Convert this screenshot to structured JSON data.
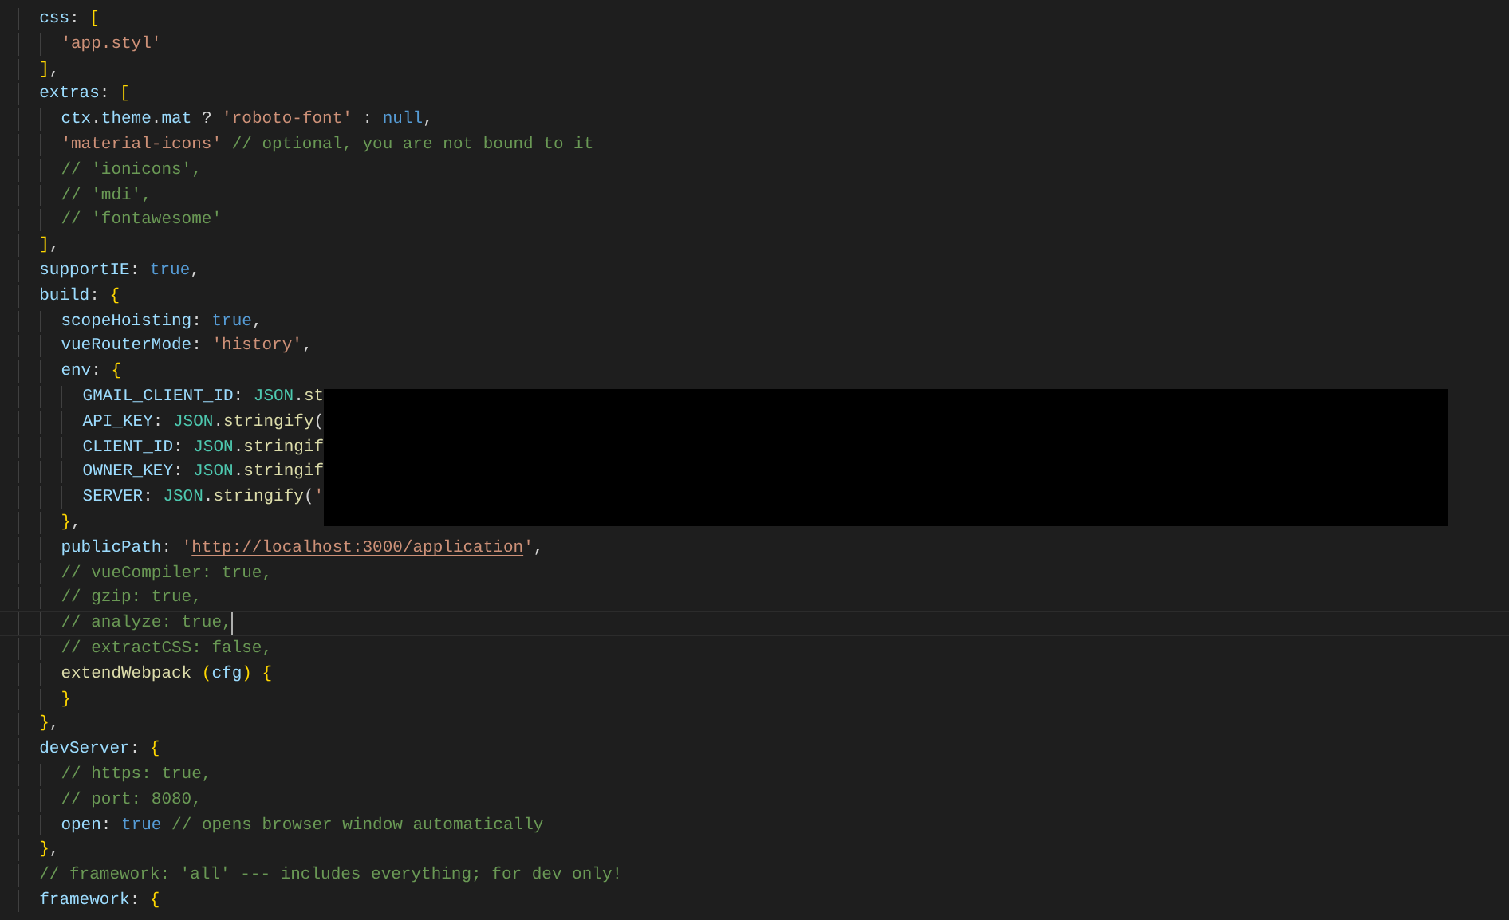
{
  "editor": {
    "lines": [
      {
        "tokens": [
          {
            "kind": "prop",
            "text": "css"
          },
          {
            "kind": "punct",
            "text": ": "
          },
          {
            "kind": "bracket",
            "text": "["
          }
        ],
        "children": [
          {
            "tokens": [
              {
                "kind": "string",
                "text": "'app.styl'"
              }
            ]
          }
        ]
      },
      {
        "tokens": [
          {
            "kind": "bracket",
            "text": "]"
          },
          {
            "kind": "punct",
            "text": ","
          }
        ]
      },
      {
        "tokens": [
          {
            "kind": "prop",
            "text": "extras"
          },
          {
            "kind": "punct",
            "text": ": "
          },
          {
            "kind": "bracket",
            "text": "["
          }
        ],
        "children": [
          {
            "tokens": [
              {
                "kind": "prop",
                "text": "ctx"
              },
              {
                "kind": "punct",
                "text": "."
              },
              {
                "kind": "prop",
                "text": "theme"
              },
              {
                "kind": "punct",
                "text": "."
              },
              {
                "kind": "prop",
                "text": "mat"
              },
              {
                "kind": "punct",
                "text": " ? "
              },
              {
                "kind": "string",
                "text": "'roboto-font'"
              },
              {
                "kind": "punct",
                "text": " : "
              },
              {
                "kind": "keyword",
                "text": "null"
              },
              {
                "kind": "punct",
                "text": ","
              }
            ]
          },
          {
            "tokens": [
              {
                "kind": "string",
                "text": "'material-icons'"
              },
              {
                "kind": "comment",
                "text": " // optional, you are not bound to it"
              }
            ]
          },
          {
            "tokens": [
              {
                "kind": "comment",
                "text": "// 'ionicons',"
              }
            ]
          },
          {
            "tokens": [
              {
                "kind": "comment",
                "text": "// 'mdi',"
              }
            ]
          },
          {
            "tokens": [
              {
                "kind": "comment",
                "text": "// 'fontawesome'"
              }
            ]
          }
        ]
      },
      {
        "tokens": [
          {
            "kind": "bracket",
            "text": "]"
          },
          {
            "kind": "punct",
            "text": ","
          }
        ]
      },
      {
        "tokens": [
          {
            "kind": "prop",
            "text": "supportIE"
          },
          {
            "kind": "punct",
            "text": ": "
          },
          {
            "kind": "keyword",
            "text": "true"
          },
          {
            "kind": "punct",
            "text": ","
          }
        ]
      },
      {
        "tokens": [
          {
            "kind": "prop",
            "text": "build"
          },
          {
            "kind": "punct",
            "text": ": "
          },
          {
            "kind": "bracket",
            "text": "{"
          }
        ],
        "children": [
          {
            "tokens": [
              {
                "kind": "prop",
                "text": "scopeHoisting"
              },
              {
                "kind": "punct",
                "text": ": "
              },
              {
                "kind": "keyword",
                "text": "true"
              },
              {
                "kind": "punct",
                "text": ","
              }
            ]
          },
          {
            "tokens": [
              {
                "kind": "prop",
                "text": "vueRouterMode"
              },
              {
                "kind": "punct",
                "text": ": "
              },
              {
                "kind": "string",
                "text": "'history'"
              },
              {
                "kind": "punct",
                "text": ","
              }
            ]
          },
          {
            "tokens": [
              {
                "kind": "prop",
                "text": "env"
              },
              {
                "kind": "punct",
                "text": ": "
              },
              {
                "kind": "bracket",
                "text": "{"
              }
            ],
            "children": [
              {
                "tokens": [
                  {
                    "kind": "prop",
                    "text": "GMAIL_CLIENT_ID"
                  },
                  {
                    "kind": "punct",
                    "text": ": "
                  },
                  {
                    "kind": "object",
                    "text": "JSON"
                  },
                  {
                    "kind": "punct",
                    "text": "."
                  },
                  {
                    "kind": "func",
                    "text": "st"
                  }
                ]
              },
              {
                "tokens": [
                  {
                    "kind": "prop",
                    "text": "API_KEY"
                  },
                  {
                    "kind": "punct",
                    "text": ": "
                  },
                  {
                    "kind": "object",
                    "text": "JSON"
                  },
                  {
                    "kind": "punct",
                    "text": "."
                  },
                  {
                    "kind": "func",
                    "text": "stringify"
                  },
                  {
                    "kind": "punct",
                    "text": "("
                  }
                ]
              },
              {
                "tokens": [
                  {
                    "kind": "prop",
                    "text": "CLIENT_ID"
                  },
                  {
                    "kind": "punct",
                    "text": ": "
                  },
                  {
                    "kind": "object",
                    "text": "JSON"
                  },
                  {
                    "kind": "punct",
                    "text": "."
                  },
                  {
                    "kind": "func",
                    "text": "stringif"
                  }
                ]
              },
              {
                "tokens": [
                  {
                    "kind": "prop",
                    "text": "OWNER_KEY"
                  },
                  {
                    "kind": "punct",
                    "text": ": "
                  },
                  {
                    "kind": "object",
                    "text": "JSON"
                  },
                  {
                    "kind": "punct",
                    "text": "."
                  },
                  {
                    "kind": "func",
                    "text": "stringif"
                  }
                ]
              },
              {
                "tokens": [
                  {
                    "kind": "prop",
                    "text": "SERVER"
                  },
                  {
                    "kind": "punct",
                    "text": ": "
                  },
                  {
                    "kind": "object",
                    "text": "JSON"
                  },
                  {
                    "kind": "punct",
                    "text": "."
                  },
                  {
                    "kind": "func",
                    "text": "stringify"
                  },
                  {
                    "kind": "punct",
                    "text": "("
                  },
                  {
                    "kind": "string",
                    "text": "'"
                  }
                ]
              }
            ]
          },
          {
            "tokens": [
              {
                "kind": "bracket",
                "text": "}"
              },
              {
                "kind": "punct",
                "text": ","
              }
            ]
          },
          {
            "tokens": [
              {
                "kind": "prop",
                "text": "publicPath"
              },
              {
                "kind": "punct",
                "text": ": "
              },
              {
                "kind": "string",
                "text": "'"
              },
              {
                "kind": "link",
                "text": "http://localhost:3000/application"
              },
              {
                "kind": "string",
                "text": "'"
              },
              {
                "kind": "punct",
                "text": ","
              }
            ]
          },
          {
            "tokens": [
              {
                "kind": "comment",
                "text": "// vueCompiler: true,"
              }
            ]
          },
          {
            "tokens": [
              {
                "kind": "comment",
                "text": "// gzip: true,"
              }
            ]
          },
          {
            "current": true,
            "tokens": [
              {
                "kind": "comment",
                "text": "// analyze: true,"
              }
            ]
          },
          {
            "tokens": [
              {
                "kind": "comment",
                "text": "// extractCSS: false,"
              }
            ]
          },
          {
            "tokens": [
              {
                "kind": "func",
                "text": "extendWebpack"
              },
              {
                "kind": "bracket",
                "text": " ("
              },
              {
                "kind": "prop",
                "text": "cfg"
              },
              {
                "kind": "bracket",
                "text": ")"
              },
              {
                "kind": "bracket",
                "text": " {"
              }
            ]
          },
          {
            "tokens": [
              {
                "kind": "bracket",
                "text": "}"
              }
            ]
          }
        ]
      },
      {
        "tokens": [
          {
            "kind": "bracket",
            "text": "}"
          },
          {
            "kind": "punct",
            "text": ","
          }
        ]
      },
      {
        "tokens": [
          {
            "kind": "prop",
            "text": "devServer"
          },
          {
            "kind": "punct",
            "text": ": "
          },
          {
            "kind": "bracket",
            "text": "{"
          }
        ],
        "children": [
          {
            "tokens": [
              {
                "kind": "comment",
                "text": "// https: true,"
              }
            ]
          },
          {
            "tokens": [
              {
                "kind": "comment",
                "text": "// port: 8080,"
              }
            ]
          },
          {
            "tokens": [
              {
                "kind": "prop",
                "text": "open"
              },
              {
                "kind": "punct",
                "text": ": "
              },
              {
                "kind": "keyword",
                "text": "true"
              },
              {
                "kind": "comment",
                "text": " // opens browser window automatically"
              }
            ]
          }
        ]
      },
      {
        "tokens": [
          {
            "kind": "bracket",
            "text": "}"
          },
          {
            "kind": "punct",
            "text": ","
          }
        ]
      },
      {
        "tokens": [
          {
            "kind": "comment",
            "text": "// framework: 'all' --- includes everything; for dev only!"
          }
        ]
      },
      {
        "tokens": [
          {
            "kind": "prop",
            "text": "framework"
          },
          {
            "kind": "punct",
            "text": ": "
          },
          {
            "kind": "bracket",
            "text": "{"
          }
        ]
      }
    ]
  }
}
